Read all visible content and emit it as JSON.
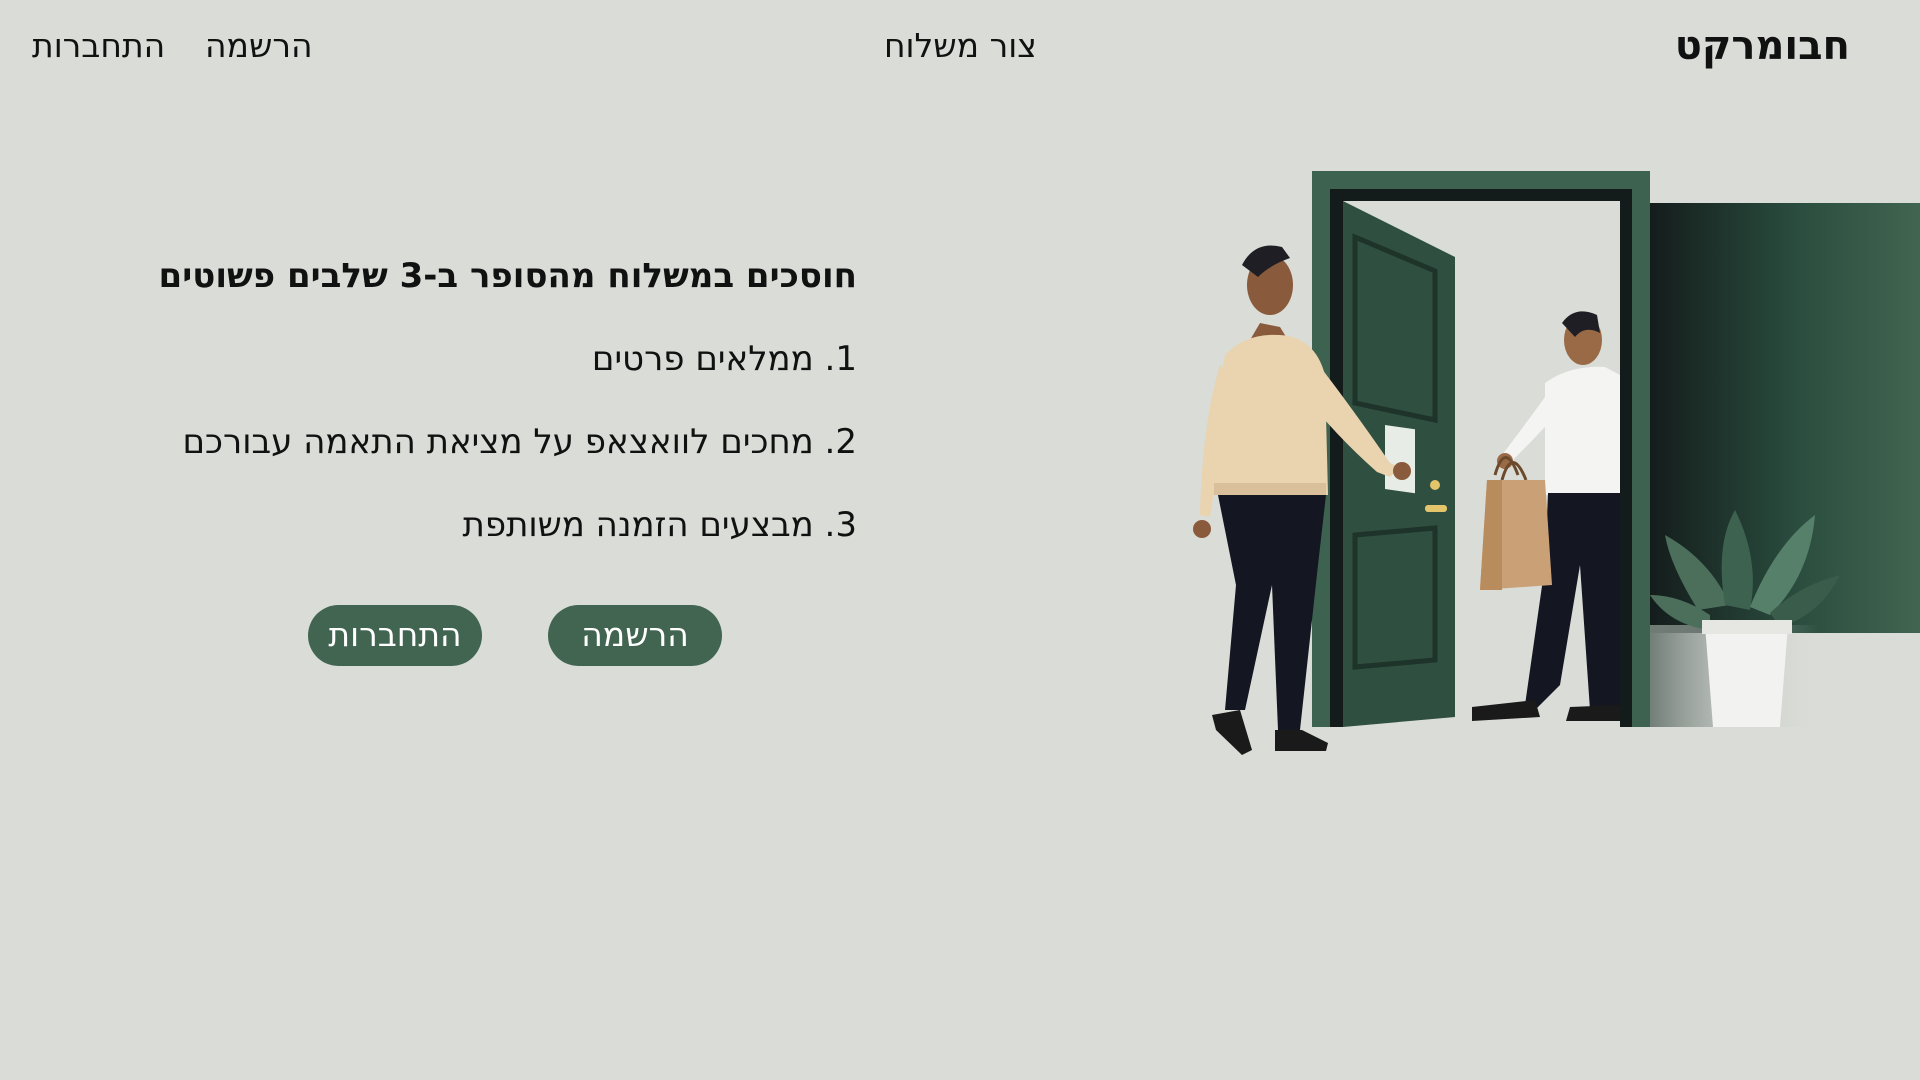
{
  "header": {
    "brand": "חבומרקט",
    "nav_center": "צור משלוח",
    "nav_register": "הרשמה",
    "nav_login": "התחברות"
  },
  "main": {
    "heading": "חוסכים במשלוח מהסופר ב-3 שלבים פשוטים",
    "steps": [
      "1. ממלאים פרטים",
      "2. מחכים לוואצאפ על מציאת התאמה עבורכם",
      "3. מבצעים הזמנה משותפת"
    ],
    "register_button": "הרשמה",
    "login_button": "התחברות"
  },
  "colors": {
    "background": "#d9dcd7",
    "accent": "#416550",
    "door": "#2f4f40"
  },
  "illustration": {
    "icon": "delivery-handoff-illustration"
  }
}
